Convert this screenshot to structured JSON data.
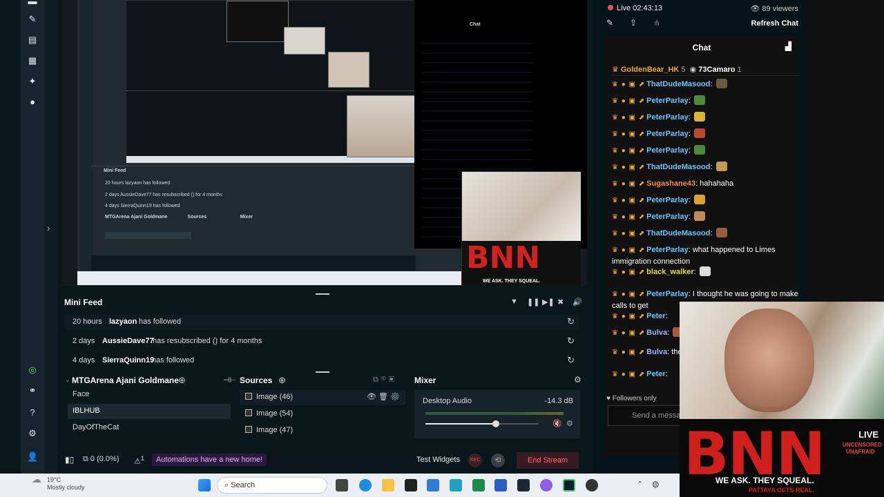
{
  "stream": {
    "live_label": "Live 02:43:13",
    "viewers": "89 viewers",
    "refresh_chat": "Refresh Chat"
  },
  "mini_feed": {
    "title": "Mini Feed",
    "rows": [
      {
        "time": "20 hours",
        "user": "lazyaon",
        "action": "has followed"
      },
      {
        "time": "2 days",
        "user": "AussieDave77",
        "action": "has resubscribed () for 4 months"
      },
      {
        "time": "4 days",
        "user": "SierraQuinn19",
        "action": "has followed"
      }
    ]
  },
  "scenes": {
    "title": "MTGArena Ajani Goldmane",
    "items": [
      "Face",
      "IBLHUB",
      "DayOfTheCat"
    ],
    "selected": "IBLHUB"
  },
  "sources": {
    "title": "Sources",
    "items": [
      "Image (46)",
      "Image (54)",
      "Image (47)"
    ]
  },
  "mixer": {
    "title": "Mixer",
    "channel": "Desktop Audio",
    "db": "-14.3 dB",
    "volume_level": 0.62
  },
  "footer": {
    "performance": "0 (0.0%)",
    "alert_count": "1",
    "automations": "Automations have a new home!",
    "test_widgets": "Test Widgets",
    "rec": "REC",
    "end_stream": "End Stream"
  },
  "chat": {
    "title": "Chat",
    "top_users": [
      {
        "name": "GoldenBear_HK",
        "count": "5"
      },
      {
        "name": "73Camaro",
        "count": "1"
      }
    ],
    "messages": [
      {
        "user": "ThatDudeMasood",
        "text": "",
        "color": "#6ec6ff"
      },
      {
        "user": "PeterParlay",
        "text": "",
        "color": "#6ec6ff"
      },
      {
        "user": "PeterParlay",
        "text": "",
        "color": "#6ec6ff"
      },
      {
        "user": "PeterParlay",
        "text": "",
        "color": "#6ec6ff"
      },
      {
        "user": "PeterParlay",
        "text": "",
        "color": "#6ec6ff"
      },
      {
        "user": "ThatDudeMasood",
        "text": "",
        "color": "#6ec6ff"
      },
      {
        "user": "Sugashane43",
        "text": "hahahaha",
        "color": "#f28b3c"
      },
      {
        "user": "PeterParlay",
        "text": "",
        "color": "#6ec6ff"
      },
      {
        "user": "PeterParlay",
        "text": "",
        "color": "#6ec6ff"
      },
      {
        "user": "ThatDudeMasood",
        "text": "",
        "color": "#6ec6ff"
      },
      {
        "user": "PeterParlay",
        "text": "what happened to Limes immigration connection",
        "color": "#6ec6ff"
      },
      {
        "user": "black_walker",
        "text": "",
        "color": "#e7d84b"
      },
      {
        "user": "PeterParlay",
        "text": "I thought he was going to make calls to get",
        "color": "#6ec6ff"
      },
      {
        "user": "Peter",
        "text": "",
        "color": "#6ec6ff"
      },
      {
        "user": "Bulva",
        "text": "",
        "color": "#9ab6ff"
      },
      {
        "user": "Bulva",
        "text": "the way s black",
        "color": "#9ab6ff"
      },
      {
        "user": "Peter",
        "text": "",
        "color": "#6ec6ff"
      }
    ],
    "followers_only": "Followers only",
    "send_placeholder": "Send a messa"
  },
  "overlay": {
    "brand": "BNN",
    "live": "LIVE",
    "live_sub": "UNCENSORED UNAFRAID",
    "slogan": "WE ASK. THEY SQUEAL.",
    "slogan2": "PATTAYA GETS REAL."
  },
  "taskbar": {
    "weather_temp": "19°C",
    "weather_desc": "Mostly cloudy",
    "search": "Search"
  }
}
